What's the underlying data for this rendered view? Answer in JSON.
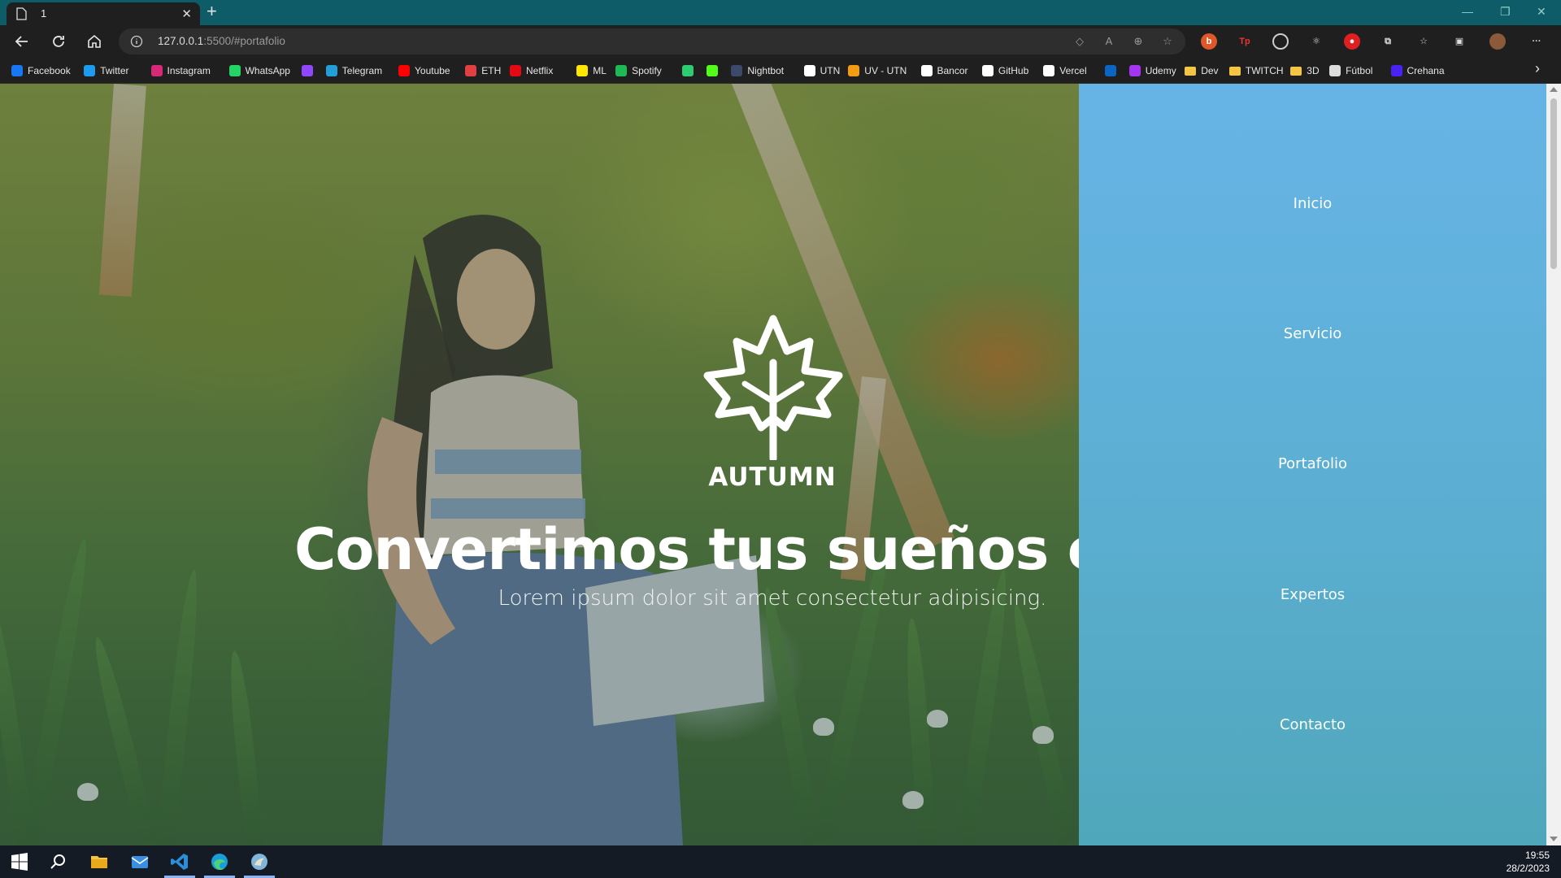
{
  "browser": {
    "tab_title": "1",
    "url_host": "127.0.0.1",
    "url_rest": ":5500/#portafolio",
    "bookmarks": [
      {
        "label": "Facebook",
        "icon": "facebook-icon",
        "color": "#1877f2"
      },
      {
        "label": "Twitter",
        "icon": "twitter-icon",
        "color": "#1d9bf0"
      },
      {
        "label": "Instagram",
        "icon": "instagram-icon",
        "color": "#d62976"
      },
      {
        "label": "WhatsApp",
        "icon": "whatsapp-icon",
        "color": "#25d366"
      },
      {
        "label": "",
        "icon": "twitch-icon",
        "color": "#9146ff"
      },
      {
        "label": "Telegram",
        "icon": "telegram-icon",
        "color": "#229ed9"
      },
      {
        "label": "Youtube",
        "icon": "youtube-icon",
        "color": "#ff0000"
      },
      {
        "label": "ETH",
        "icon": "eth-icon",
        "color": "#e24040"
      },
      {
        "label": "Netflix",
        "icon": "netflix-icon",
        "color": "#e50914"
      },
      {
        "label": "ML",
        "icon": "mercadolibre-icon",
        "color": "#ffe600"
      },
      {
        "label": "Spotify",
        "icon": "spotify-icon",
        "color": "#1db954"
      },
      {
        "label": "",
        "icon": "clover-icon",
        "color": "#2ecc71"
      },
      {
        "label": "",
        "icon": "kick-icon",
        "color": "#53fc18"
      },
      {
        "label": "Nightbot",
        "icon": "nightbot-icon",
        "color": "#3b4a6b"
      },
      {
        "label": "UTN",
        "icon": "utn-icon",
        "color": "#ffffff"
      },
      {
        "label": "UV - UTN",
        "icon": "uv-utn-icon",
        "color": "#f39c12"
      },
      {
        "label": "Bancor",
        "icon": "bancor-icon",
        "color": "#ffffff"
      },
      {
        "label": "GitHub",
        "icon": "github-icon",
        "color": "#ffffff"
      },
      {
        "label": "Vercel",
        "icon": "vercel-icon",
        "color": "#ffffff"
      },
      {
        "label": "",
        "icon": "linkedin-icon",
        "color": "#0a66c2"
      },
      {
        "label": "Udemy",
        "icon": "udemy-icon",
        "color": "#a435f0"
      },
      {
        "label": "Dev",
        "icon": "folder-icon",
        "color": "#f4c542"
      },
      {
        "label": "TWITCH",
        "icon": "folder-icon",
        "color": "#f4c542"
      },
      {
        "label": "3D",
        "icon": "folder-icon",
        "color": "#f4c542"
      },
      {
        "label": "Fútbol",
        "icon": "page-icon",
        "color": "#dddddd"
      },
      {
        "label": "Crehana",
        "icon": "crehana-icon",
        "color": "#4b22f4"
      }
    ]
  },
  "hero": {
    "logo_text": "AUTUMN",
    "headline": "Convertimos tus sueños en re",
    "subline": "Lorem ipsum dolor sit amet consectetur adipisicing."
  },
  "nav": {
    "items": [
      {
        "label": "Inicio"
      },
      {
        "label": "Servicio"
      },
      {
        "label": "Portafolio"
      },
      {
        "label": "Expertos"
      },
      {
        "label": "Contacto"
      }
    ]
  },
  "taskbar": {
    "time": "19:55",
    "date": "28/2/2023"
  },
  "colors": {
    "nav_top": "#66b4e6",
    "nav_bottom": "#4fa7bb",
    "tab_strip": "#0e5c68"
  }
}
